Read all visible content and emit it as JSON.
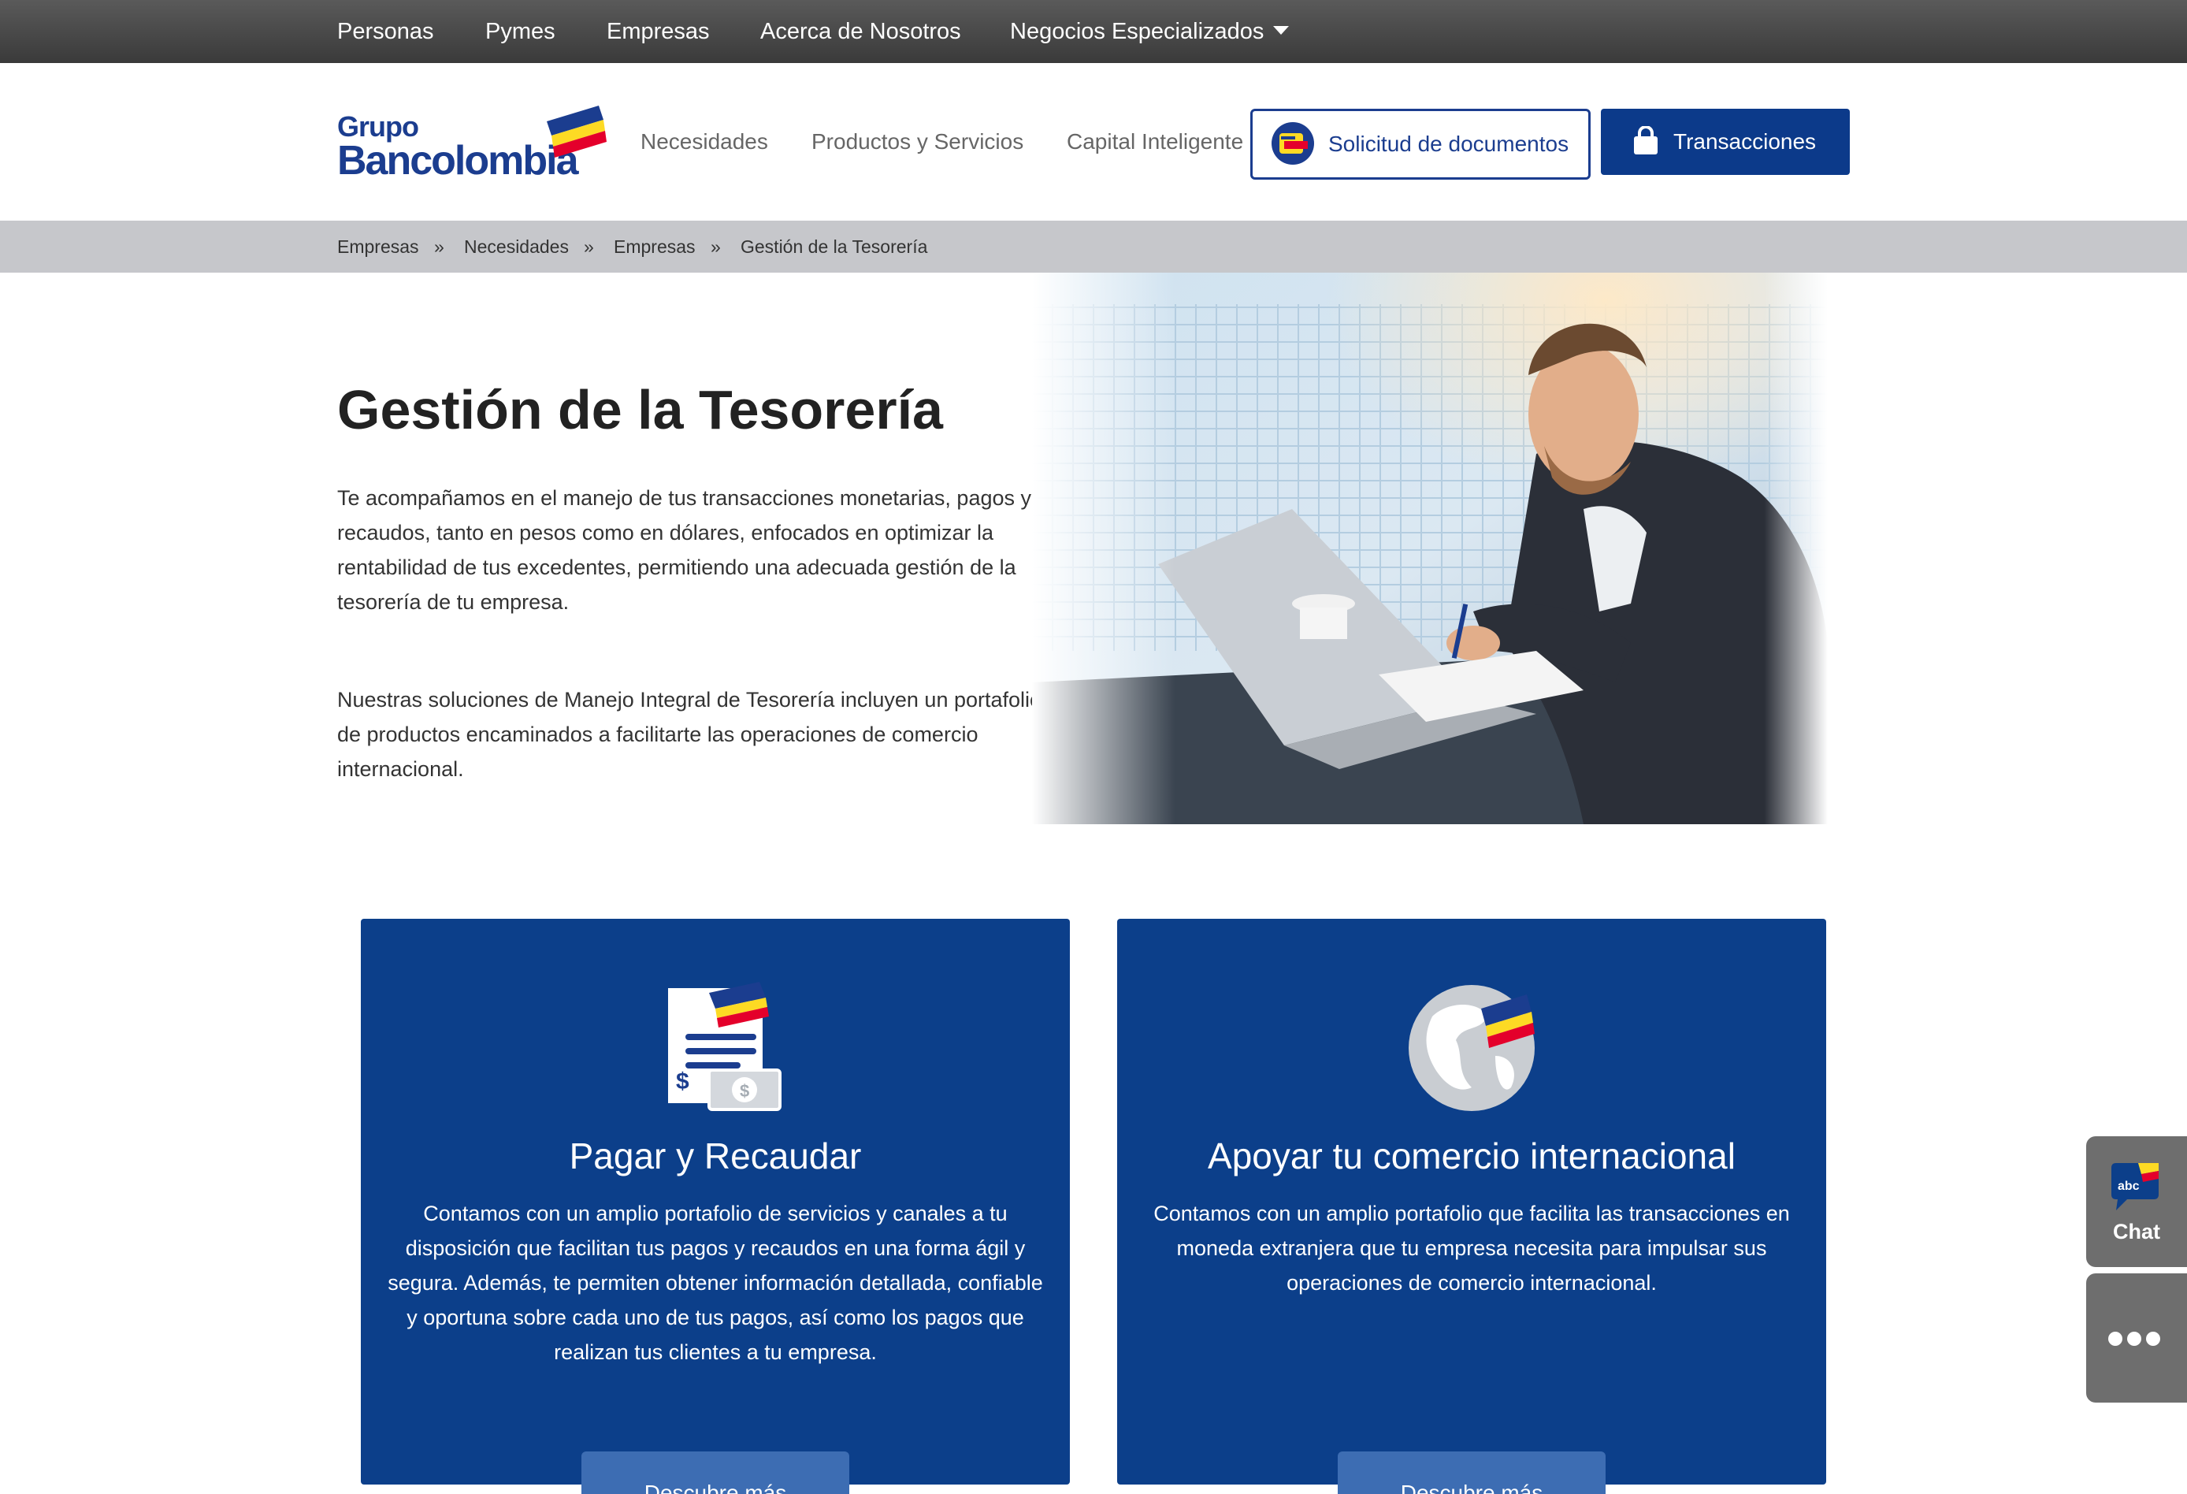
{
  "topbar": {
    "items": [
      {
        "label": "Personas"
      },
      {
        "label": "Pymes"
      },
      {
        "label": "Empresas"
      },
      {
        "label": "Acerca de Nosotros"
      },
      {
        "label": "Negocios Especializados"
      }
    ]
  },
  "header": {
    "logo": {
      "line1": "Grupo",
      "line2": "Bancolombia"
    },
    "nav": [
      {
        "label": "Necesidades"
      },
      {
        "label": "Productos y Servicios"
      },
      {
        "label": "Capital Inteligente"
      }
    ],
    "docs_button": "Solicitud de documentos",
    "transactions_button": "Transacciones"
  },
  "breadcrumb": {
    "items": [
      "Empresas",
      "Necesidades",
      "Empresas",
      "Gestión de la Tesorería"
    ],
    "separator": "»"
  },
  "hero": {
    "title": "Gestión de la Tesorería",
    "paragraph1": "Te acompañamos en el manejo de tus transacciones monetarias, pagos y recaudos, tanto en pesos como en dólares, enfocados en optimizar la rentabilidad de tus excedentes, permitiendo una adecuada gestión de la tesorería de tu empresa.",
    "paragraph2": "Nuestras soluciones de Manejo Integral de Tesorería incluyen un portafolio de productos encaminados a facilitarte las operaciones de comercio internacional."
  },
  "cards": [
    {
      "icon": "invoice-money-icon",
      "title": "Pagar y Recaudar",
      "text": "Contamos con un amplio portafolio de servicios y canales a tu disposición que facilitan tus pagos y recaudos en una forma  ágil y segura. Además,  te permiten obtener información detallada, confiable y oportuna sobre cada uno de tus pagos, así como los pagos que realizan tus clientes a tu empresa.",
      "button": "Descubre más"
    },
    {
      "icon": "globe-icon",
      "title": "Apoyar tu comercio internacional",
      "text": "Contamos con un amplio portafolio que facilita las transacciones en moneda extranjera que tu empresa necesita para impulsar sus operaciones de comercio internacional.",
      "button": "Descubre más"
    }
  ],
  "side": {
    "chat_badge": "abc",
    "chat_label": "Chat"
  },
  "colors": {
    "brand_blue": "#0c3f8a",
    "button_blue": "#3d6db3",
    "flag_yellow": "#fdda24",
    "flag_red": "#e4002b"
  }
}
